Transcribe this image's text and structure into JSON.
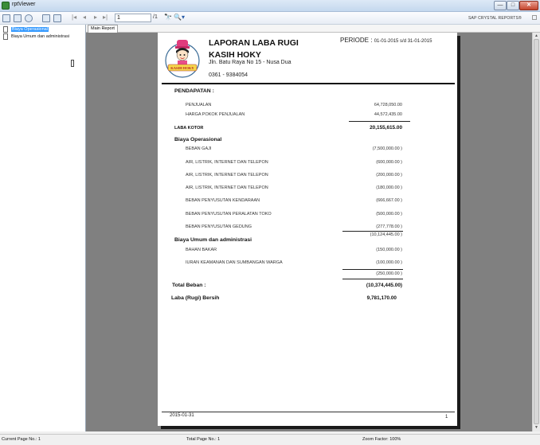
{
  "window": {
    "title": "rptViewer",
    "min": "—",
    "max": "□",
    "close": "✕"
  },
  "toolbar": {
    "icons": [
      "export-icon",
      "print-icon",
      "refresh-icon",
      "toggle-group-tree-icon",
      "toggle-parameters-icon"
    ],
    "nav": {
      "first": "|◂",
      "prev": "◂",
      "next": "▸",
      "last": "▸|"
    },
    "page_value": "1",
    "page_total": "/1",
    "sap_label": "SAP CRYSTAL REPORTS®"
  },
  "tree": {
    "items": [
      {
        "label": "Biaya Operasional",
        "selected": true
      },
      {
        "label": "Biaya Umum dan administrasi",
        "selected": false
      }
    ]
  },
  "tab": {
    "label": "Main Report"
  },
  "report": {
    "logo_text": "KASIH HOKY",
    "title": "LAPORAN LABA RUGI",
    "period_label": "PERIODE :",
    "period_value": "01-01-2015 s/d 31-01-2015",
    "company": "KASIH HOKY",
    "address": "Jln. Batu Raya No 15 - Nusa Dua",
    "phone": "0361 - 9384054",
    "pendapatan_header": "PENDAPATAN :",
    "penjualan_label": "PENJUALAN",
    "penjualan_value": "64,728,050.00",
    "hpp_label": "HARGA POKOK PENJUALAN",
    "hpp_value": "44,572,435.00",
    "laba_kotor_label": "LABA KOTOR",
    "laba_kotor_value": "20,155,615.00",
    "biaya_operasional_header": "Biaya Operasional",
    "operasional": [
      {
        "label": "BEBAN GAJI",
        "value": "(7,500,000.00 )"
      },
      {
        "label": "AIR, LISTRIK, INTERNET DAN TELEPON",
        "value": "(600,000.00 )"
      },
      {
        "label": "AIR, LISTRIK, INTERNET DAN TELEPON",
        "value": "(200,000.00 )"
      },
      {
        "label": "AIR, LISTRIK, INTERNET DAN TELEPON",
        "value": "(180,000.00 )"
      },
      {
        "label": "BEBAN PENYUSUTAN KENDARAAN",
        "value": "(666,667.00 )"
      },
      {
        "label": "BEBAN PENYUSUTAN PERALATAN TOKO",
        "value": "(500,000.00 )"
      },
      {
        "label": "BEBAN PENYUSUTAN GEDUNG",
        "value": "(277,778.00 )"
      }
    ],
    "operasional_total": "(10,124,445.00 )",
    "biaya_umum_header": "Biaya Umum dan administrasi",
    "umum": [
      {
        "label": "BAHAN BAKAR",
        "value": "(150,000.00 )"
      },
      {
        "label": "IURAN KEAMANAN DAN SUMBANGAN WARGA",
        "value": "(100,000.00 )"
      }
    ],
    "umum_total": "(250,000.00 )",
    "total_beban_label": "Total Beban :",
    "total_beban_value": "(10,374,445.00)",
    "laba_bersih_label": "Laba (Rugi) Bersih",
    "laba_bersih_value": "9,781,170.00",
    "footer_date": "2015-01-31",
    "footer_page": "1"
  },
  "status": {
    "current_page": "Current Page No.: 1",
    "total_page": "Total Page No.: 1",
    "zoom": "Zoom Factor: 100%"
  }
}
